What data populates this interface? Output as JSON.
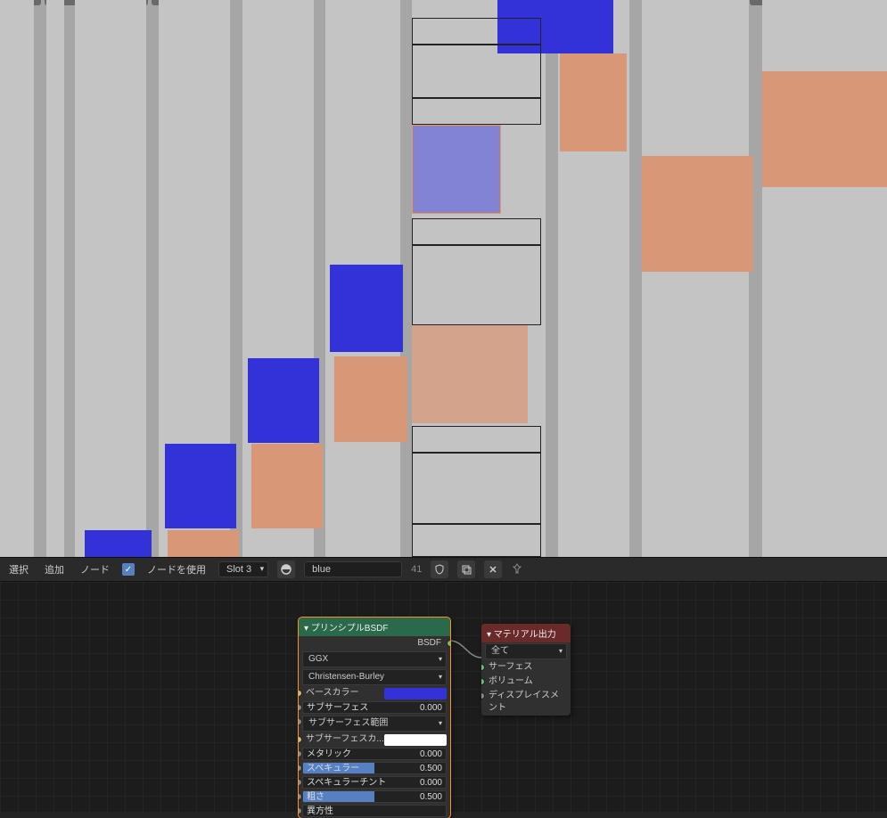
{
  "toolbar": {
    "select": "選択",
    "add": "追加",
    "node": "ノード",
    "use_nodes": "ノードを使用",
    "slot": "Slot 3",
    "material_name": "blue",
    "users": "41"
  },
  "principled": {
    "title": "▾ プリンシプルBSDF",
    "bsdf_out": "BSDF",
    "distribution": "GGX",
    "subsurface_method": "Christensen-Burley",
    "base_color_label": "ベースカラー",
    "base_color": "#3232d8",
    "subsurface_label": "サブサーフェス",
    "subsurface_value": "0.000",
    "subsurface_radius_label": "サブサーフェス範囲",
    "subsurface_color_label": "サブサーフェスカ...",
    "subsurface_color": "#ffffff",
    "metallic_label": "メタリック",
    "metallic_value": "0.000",
    "specular_label": "スペキュラー",
    "specular_value": "0.500",
    "specular_tint_label": "スペキュラーチント",
    "specular_tint_value": "0.000",
    "roughness_label": "粗さ",
    "roughness_value": "0.500",
    "anisotropic_label": "異方性"
  },
  "output": {
    "title": "▾ マテリアル出力",
    "target": "全て",
    "surface": "サーフェス",
    "volume": "ボリューム",
    "displacement": "ディスプレイスメント"
  }
}
